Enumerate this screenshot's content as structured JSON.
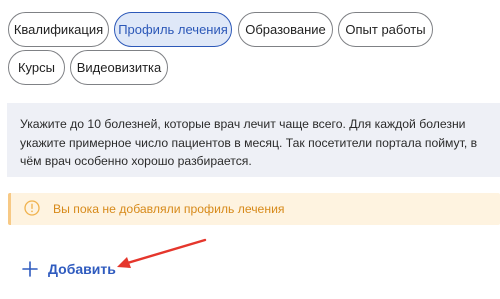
{
  "tabs": [
    {
      "label": "Квалификация",
      "active": false
    },
    {
      "label": "Профиль лечения",
      "active": true
    },
    {
      "label": "Образование",
      "active": false
    },
    {
      "label": "Опыт работы",
      "active": false
    },
    {
      "label": "Курсы",
      "active": false
    },
    {
      "label": "Видеовизитка",
      "active": false
    }
  ],
  "info": {
    "text": "Укажите до 10 болезней, которые врач лечит чаще всего. Для каждой болезни укажите примерное число пациентов в месяц. Так посетители портала поймут, в чём врач особенно хорошо разбирается."
  },
  "notice": {
    "icon": "info-circle-icon",
    "text": "Вы пока не добавляли профиль лечения"
  },
  "add_button": {
    "icon": "plus-icon",
    "label": "Добавить"
  },
  "annotation": {
    "icon": "red-arrow-icon"
  },
  "colors": {
    "accent": "#2f5bbf",
    "active_chip_bg": "#dfe8f8",
    "info_bg": "#eef0f6",
    "warning_bg": "#fef3e0",
    "warning_text": "#d78a1a",
    "annotation_red": "#e5362c"
  }
}
